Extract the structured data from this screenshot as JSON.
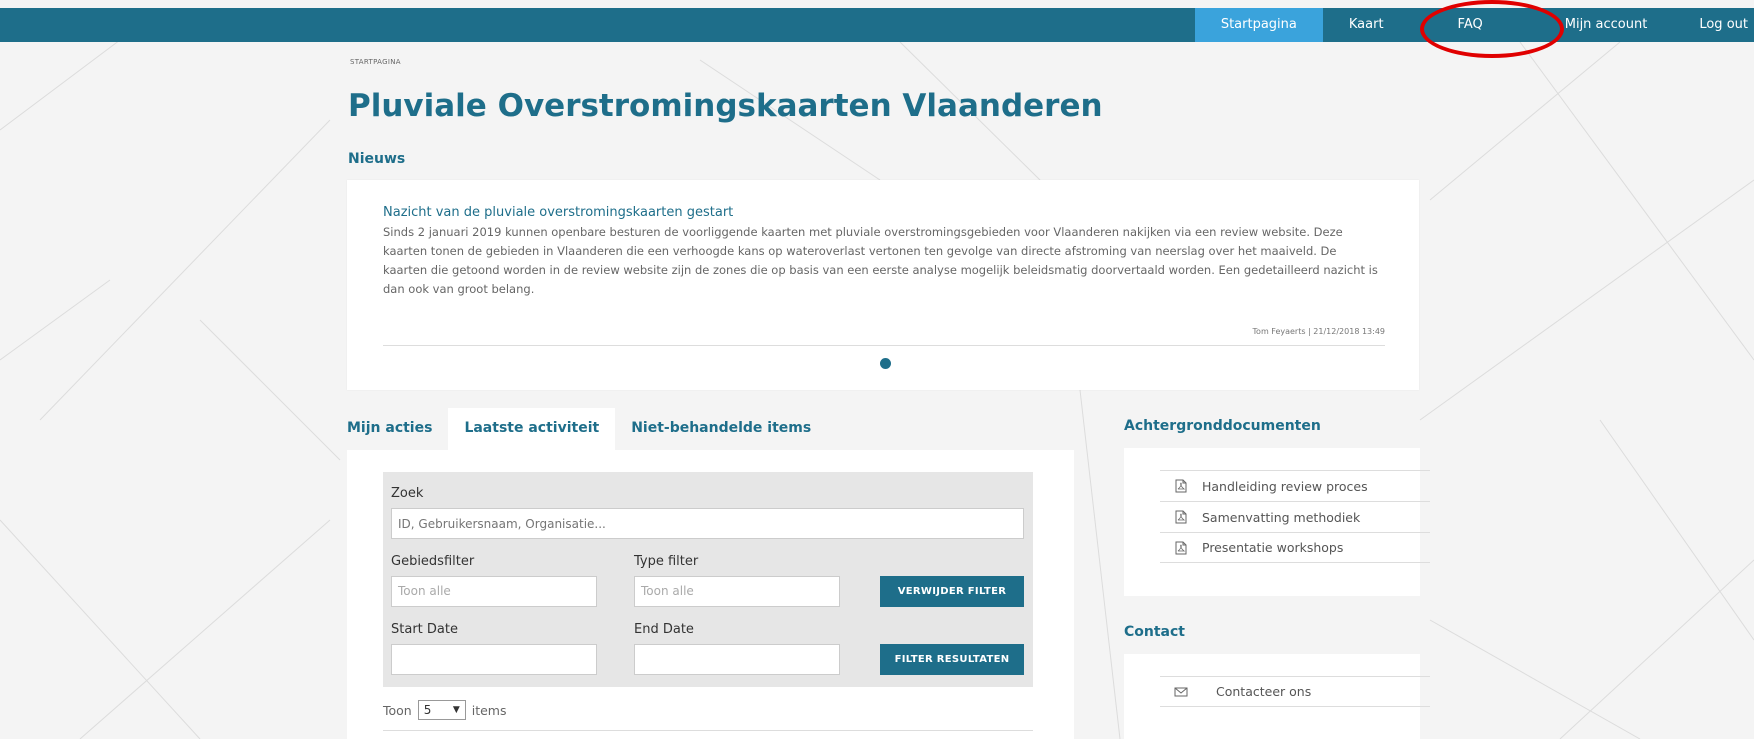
{
  "nav": {
    "items": [
      "Startpagina",
      "Kaart",
      "FAQ",
      "Mijn account",
      "Log out"
    ],
    "active": "Startpagina"
  },
  "breadcrumb": "STARTPAGINA",
  "page_title": "Pluviale Overstromingskaarten Vlaanderen",
  "news": {
    "section_title": "Nieuws",
    "headline": "Nazicht van de pluviale overstromingskaarten gestart",
    "body": "Sinds 2 januari 2019 kunnen openbare besturen de voorliggende kaarten met pluviale overstromingsgebieden voor Vlaanderen nakijken via een review website. Deze kaarten tonen de gebieden in Vlaanderen die een verhoogde kans op wateroverlast vertonen ten gevolge van directe afstroming van neerslag over het maaiveld. De kaarten die getoond worden in de review website zijn de zones die op basis van een eerste analyse mogelijk beleidsmatig doorvertaald worden. Een gedetailleerd nazicht is dan ook van groot belang.",
    "meta": "Tom Feyaerts | 21/12/2018 13:49"
  },
  "tabs": {
    "items": [
      "Mijn acties",
      "Laatste activiteit",
      "Niet-behandelde items"
    ],
    "active": "Laatste activiteit"
  },
  "filters": {
    "search_label": "Zoek",
    "search_placeholder": "ID, Gebruikersnaam, Organisatie...",
    "area_label": "Gebiedsfilter",
    "area_value": "Toon alle",
    "type_label": "Type filter",
    "type_value": "Toon alle",
    "clear_button": "VERWIJDER FILTER",
    "start_label": "Start Date",
    "end_label": "End Date",
    "apply_button": "FILTER RESULTATEN",
    "toon_prefix": "Toon",
    "toon_value": "5",
    "toon_suffix": "items"
  },
  "background_docs": {
    "section_title": "Achtergronddocumenten",
    "items": [
      "Handleiding review proces",
      "Samenvatting methodiek",
      "Presentatie workshops"
    ],
    "icon": "pdf-file-icon"
  },
  "contact": {
    "section_title": "Contact",
    "item": "Contacteer ons",
    "icon": "envelope-icon"
  },
  "colors": {
    "brand": "#1e6e8a",
    "nav_active": "#3aa3dc",
    "annotation": "#e00000"
  }
}
